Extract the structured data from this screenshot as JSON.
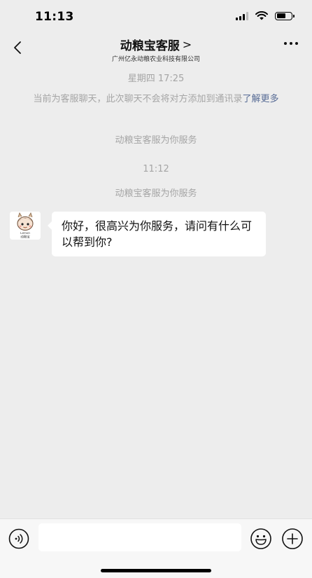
{
  "status_bar": {
    "time": "11:13"
  },
  "header": {
    "title": "动粮宝客服",
    "title_arrow": ">",
    "subtitle": "广州亿永动粮农业科技有限公司"
  },
  "messages": {
    "timestamp_1": "星期四 17:25",
    "notice_text": "当前为客服聊天，此次聊天不会将对方添加到通讯录",
    "notice_link": "了解更多",
    "service_note_1": "动粮宝客服为你服务",
    "timestamp_2": "11:12",
    "service_note_2": "动粮宝客服为你服务",
    "bubble_text": "你好，很高兴为你服务，请问有什么可以帮到你?",
    "avatar_text": "Lemon",
    "avatar_caption": "动粮宝"
  },
  "input_bar": {
    "value": "",
    "placeholder": ""
  },
  "colors": {
    "background": "#ededed",
    "link": "#576b95",
    "system_text": "#a5a5a5",
    "bubble": "#ffffff"
  }
}
